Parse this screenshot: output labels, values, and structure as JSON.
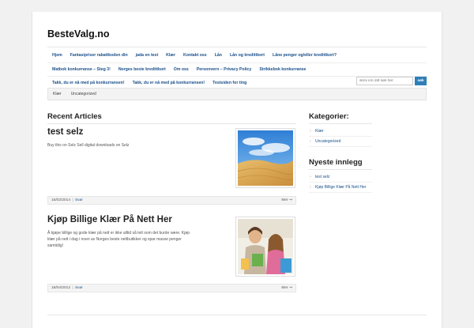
{
  "site": {
    "title": "BesteValg.no"
  },
  "nav": {
    "row1": [
      "Hjem",
      "Fantasipriser rabattkoden din",
      "jada en test",
      "Klær",
      "Kontakt oss",
      "Lån",
      "Lån og kredittkort",
      "Låne penger og/eller kredittkort?"
    ],
    "row2": [
      "Matbok konkurranse – Steg 3!",
      "Norges beste kredittkort",
      "Om oss",
      "Personvern – Privacy Policy",
      "Strikkebok konkurranse"
    ],
    "row3": [
      "Takk, du er nå med på konkurransen!",
      "Takk, du er nå med på konkurransen!",
      "Testsiden for ting"
    ]
  },
  "search": {
    "placeholder": "skriv inn ditt søk her",
    "button": "søk"
  },
  "catbar": [
    "Klær",
    "Uncategorized"
  ],
  "recent": {
    "title": "Recent Articles"
  },
  "articles": [
    {
      "title": "test selz",
      "excerpt": "Buy this on Selz Sell digital downloads on Selz",
      "date": "15/02/2014",
      "reply": "Svar",
      "more": "Mer"
    },
    {
      "title": "Kjøp Billige Klær På Nett Her",
      "excerpt_lines": [
        "Å kjøpe billige og gode klær på nett er ikke alltid så lett som det burde være. Kjøp",
        "klær på nett i dag i noen av Norges beste nettbutikker og spar masse penger",
        "samtidig!"
      ],
      "date": "18/04/2012",
      "reply": "Svar",
      "more": "Mer"
    }
  ],
  "sidebar": {
    "categories_title": "Kategorier:",
    "categories": [
      "Klær",
      "Uncategorized"
    ],
    "recent_title": "Nyeste innlegg",
    "recent_posts": [
      "test selz",
      "Kjøp Billige Klær På Nett Her"
    ]
  },
  "colors": {
    "link": "#1a4f8b",
    "button": "#2e7fb8",
    "sky": "#4a9be0",
    "sand": "#d9a84f"
  }
}
